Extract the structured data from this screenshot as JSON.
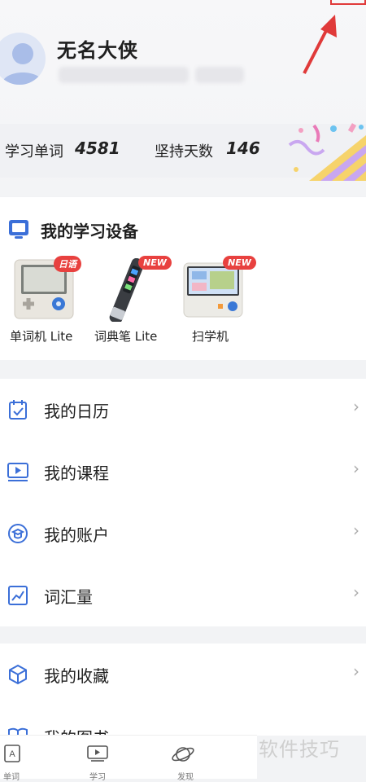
{
  "profile": {
    "name": "无名大侠"
  },
  "stats": {
    "words_label": "学习单词",
    "words_value": "4581",
    "days_label": "坚持天数",
    "days_value": "146"
  },
  "devices": {
    "title": "我的学习设备",
    "items": [
      {
        "label": "单词机 Lite",
        "badge": "日语"
      },
      {
        "label": "词典笔 Lite",
        "badge": "NEW"
      },
      {
        "label": "扫学机",
        "badge": "NEW"
      }
    ]
  },
  "menu": {
    "items": [
      {
        "label": "我的日历",
        "icon": "calendar-icon"
      },
      {
        "label": "我的课程",
        "icon": "course-icon"
      },
      {
        "label": "我的账户",
        "icon": "account-icon"
      },
      {
        "label": "词汇量",
        "icon": "chart-icon"
      },
      {
        "label": "我的收藏",
        "icon": "cube-icon"
      },
      {
        "label": "我的图书",
        "icon": "book-icon"
      }
    ],
    "chevron": "›"
  },
  "tabbar": {
    "tabs": [
      {
        "label": "单词",
        "icon": "word-icon"
      },
      {
        "label": "学习",
        "icon": "play-icon"
      },
      {
        "label": "发现",
        "icon": "planet-icon"
      }
    ]
  },
  "watermark": "软件技巧",
  "colors": {
    "accent": "#3b6fd8",
    "badge": "#e8413f",
    "annotation": "#e03a3a"
  }
}
